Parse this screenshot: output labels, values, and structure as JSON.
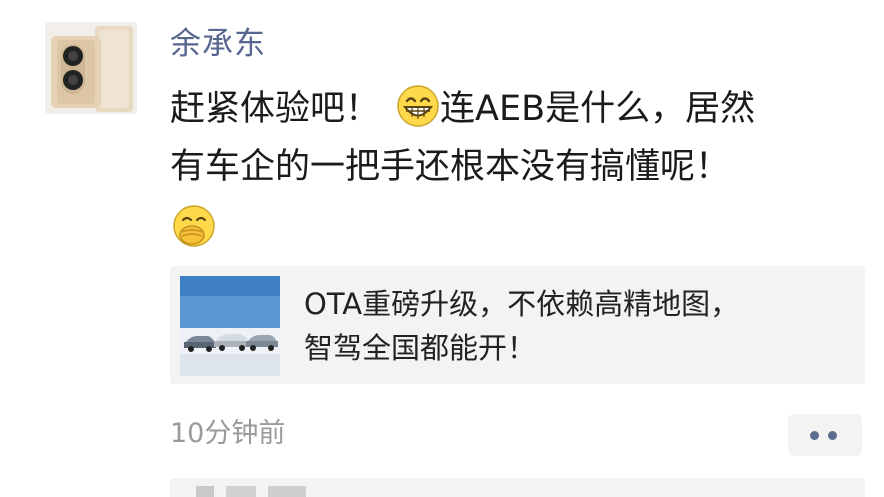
{
  "post": {
    "author": "余承东",
    "text_line1_a": "赶紧体验吧！",
    "text_line1_b": "连AEB是什么，居然",
    "text_line2": "有车企的一把手还根本没有搞懂呢！",
    "emoji_1": "grinning-face-emoji",
    "emoji_2": "face-with-hand-over-mouth-emoji"
  },
  "link_card": {
    "title_line1": "OTA重磅升级，不依赖高精地图，",
    "title_line2": "智驾全国都能开！",
    "thumbnail": "cars-on-snow-thumbnail"
  },
  "meta": {
    "timestamp": "10分钟前",
    "more_icon": "more-dots-icon"
  },
  "colors": {
    "username": "#57668f",
    "card_background": "#f3f3f3",
    "timestamp": "#9a9a9a"
  }
}
